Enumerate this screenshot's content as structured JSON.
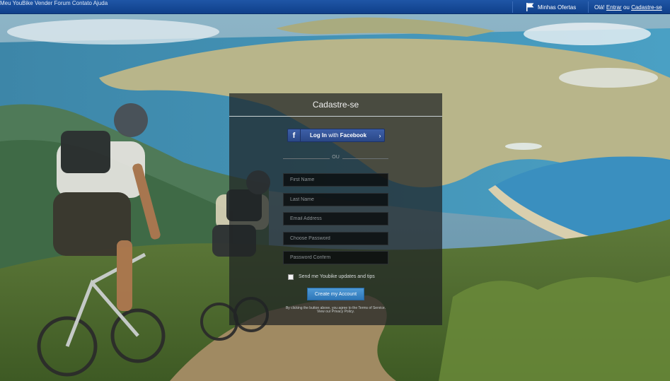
{
  "topbar": {
    "nav": [
      "Meu YouBike",
      "Vender",
      "Forum",
      "Contato",
      "Ajuda"
    ],
    "offers_label": "Minhas Ofertas",
    "greeting": "Olá!",
    "login_link": "Entrar",
    "or_word": "ou",
    "signup_link": "Cadastre-se"
  },
  "panel": {
    "title": "Cadastre-se",
    "facebook": {
      "prefix": "Log In",
      "middle": "with",
      "brand": "Facebook",
      "arrow": "›"
    },
    "or_label": "OU",
    "fields": {
      "first_name": "First Name",
      "last_name": "Last Name",
      "email": "Email Address",
      "password": "Choose Password",
      "password_confirm": "Password Confirm"
    },
    "newsletter_label": "Send me Youbike updates and tips",
    "newsletter_checked": false,
    "submit_label": "Create my Account",
    "terms_line1": "By clicking the button above, you agree to the Terms of Service.",
    "terms_line2": "View our Privacy Policy."
  },
  "colors": {
    "topbar": "#1f56a6",
    "facebook": "#3b5998",
    "submit": "#3d8bcc"
  }
}
